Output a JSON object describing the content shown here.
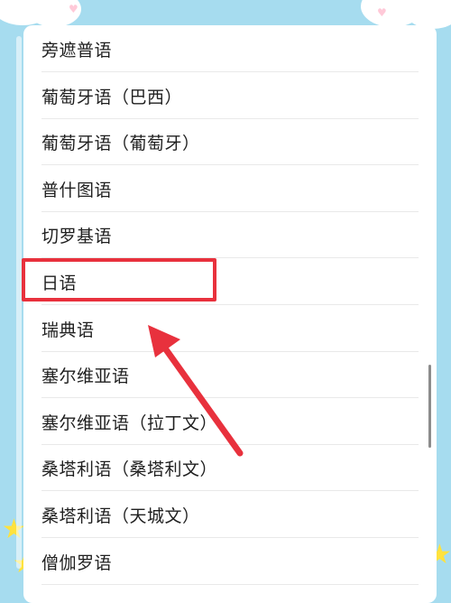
{
  "languages": [
    "旁遮普语",
    "葡萄牙语（巴西）",
    "葡萄牙语（葡萄牙）",
    "普什图语",
    "切罗基语",
    "日语",
    "瑞典语",
    "塞尔维亚语",
    "塞尔维亚语（拉丁文）",
    "桑塔利语（桑塔利文）",
    "桑塔利语（天城文）",
    "僧伽罗语"
  ],
  "highlighted_item": "日语",
  "colors": {
    "background": "#a6dcef",
    "highlight": "#e8313d",
    "arrow": "#e8313d",
    "star": "#ffe23d"
  },
  "icons": {
    "decoration_star": "star-icon",
    "decoration_heart": "heart-icon",
    "pointer": "arrow-icon"
  }
}
